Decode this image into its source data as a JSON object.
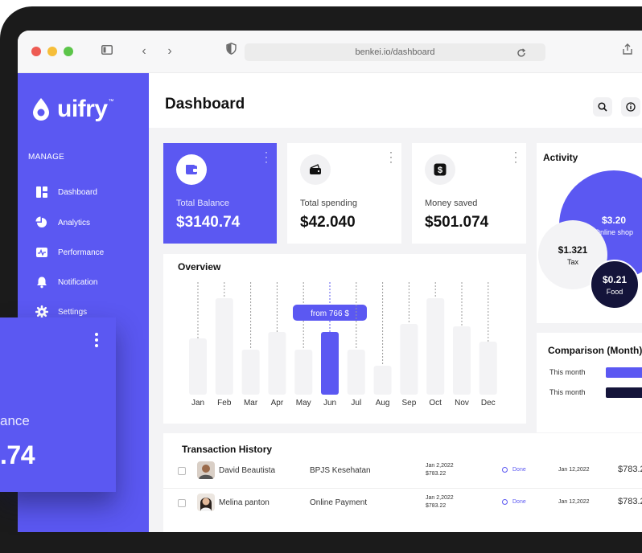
{
  "browser": {
    "url": "benkei.io/dashboard"
  },
  "brand": {
    "name": "uifry",
    "tm": "™",
    "color": "#5b58f2"
  },
  "sidebar": {
    "section": "MANAGE",
    "items": [
      {
        "label": "Dashboard",
        "icon": "dashboard-icon"
      },
      {
        "label": "Analytics",
        "icon": "analytics-icon"
      },
      {
        "label": "Performance",
        "icon": "performance-icon"
      },
      {
        "label": "Notification",
        "icon": "bell-icon"
      },
      {
        "label": "Settings",
        "icon": "gear-icon"
      }
    ]
  },
  "header": {
    "title": "Dashboard"
  },
  "cards": [
    {
      "label": "Total Balance",
      "value": "$3140.74",
      "icon": "wallet-icon"
    },
    {
      "label": "Total spending",
      "value": "$42.040",
      "icon": "purse-icon"
    },
    {
      "label": "Money saved",
      "value": "$501.074",
      "icon": "dollar-icon"
    }
  ],
  "overview": {
    "title": "Overview",
    "tooltip": "from 766 $"
  },
  "chart_data": {
    "type": "bar",
    "categories": [
      "Jan",
      "Feb",
      "Mar",
      "Apr",
      "May",
      "Jun",
      "Jul",
      "Aug",
      "Sep",
      "Oct",
      "Nov",
      "Dec"
    ],
    "values": [
      70,
      120,
      56,
      78,
      56,
      78,
      56,
      36,
      88,
      120,
      85,
      66
    ],
    "highlight": "Jun",
    "ylim": [
      0,
      140
    ],
    "grid": false
  },
  "activity": {
    "title": "Activity",
    "items": [
      {
        "value": "$3.20",
        "label": "Online shop"
      },
      {
        "value": "$1.321",
        "label": "Tax"
      },
      {
        "value": "$0.21",
        "label": "Food"
      }
    ]
  },
  "comparison": {
    "title": "Comparison (Month)",
    "rows": [
      {
        "label": "This month",
        "color": "#5b58f2"
      },
      {
        "label": "This month",
        "color": "#14143a"
      }
    ]
  },
  "transactions": {
    "title": "Transaction History",
    "rows": [
      {
        "name": "David Beautista",
        "desc": "BPJS Kesehatan",
        "date": "Jan 2,2022",
        "date_amount": "$783.22",
        "status": "Done",
        "date2": "Jan 12,2022",
        "amount": "$783.2"
      },
      {
        "name": "Melina panton",
        "desc": "Online Payment",
        "date": "Jan 2,2022",
        "date_amount": "$783.22",
        "status": "Done",
        "date2": "Jan 12,2022",
        "amount": "$783.2"
      }
    ]
  },
  "float_card": {
    "label": "ance",
    "value": ".74"
  }
}
